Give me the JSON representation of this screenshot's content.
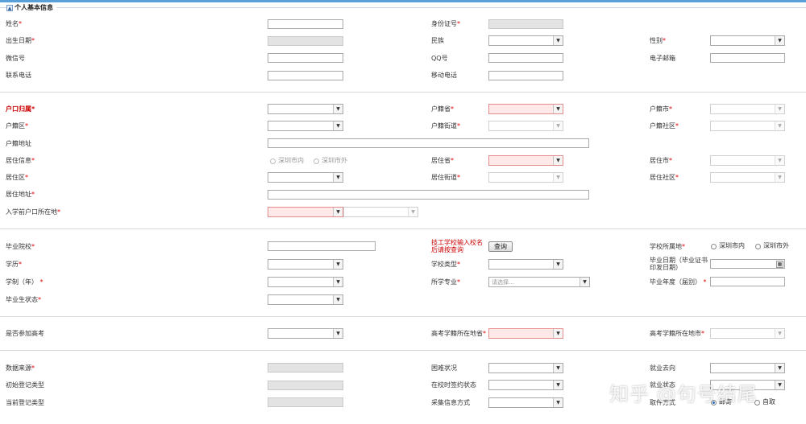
{
  "section_title": "个人基本信息",
  "collapse_glyph": "▲",
  "labels": {
    "name": "姓名",
    "id_no": "身份证号",
    "birth": "出生日期",
    "ethnic": "民族",
    "gender": "性别",
    "wechat": "微信号",
    "qq": "QQ号",
    "email": "电子邮箱",
    "phone": "联系电话",
    "mobile": "移动电话",
    "hukou": "户口归属",
    "hj_prov": "户籍省",
    "hj_city": "户籍市",
    "hj_dist": "户籍区",
    "hj_street": "户籍街道",
    "hj_comm": "户籍社区",
    "hj_addr": "户籍地址",
    "res_info": "居住信息",
    "res_prov": "居住省",
    "res_city": "居住市",
    "res_dist": "居住区",
    "res_street": "居住街道",
    "res_comm": "居住社区",
    "res_addr": "居住地址",
    "pre_hukou": "入学前户口所在地",
    "grad_school": "毕业院校",
    "school_loc": "学校所属地",
    "edu": "学历",
    "school_type": "学校类型",
    "grad_date": "毕业日期（毕业证书印发日期）",
    "length": "学制（年）",
    "major": "所学专业",
    "grad_year": "毕业年度（届别）",
    "grad_status": "毕业生状态",
    "gaokao": "是否参加高考",
    "gk_prov": "高考学籍所在地省",
    "gk_city": "高考学籍所在地市",
    "source": "数据来源",
    "hardship": "困难状况",
    "emp_dir": "就业去向",
    "init_type": "初始登记类型",
    "sign_status": "在校时签约状态",
    "emp_status": "就业状态",
    "cur_type": "当前登记类型",
    "collect": "采集信息方式",
    "fetch": "取件方式"
  },
  "school_note": "技工学校输入校名后请按查询",
  "query_button": "查询",
  "radios": {
    "sz_in": "深圳市内",
    "sz_out": "深圳市外",
    "mail": "邮寄",
    "self": "自取"
  },
  "major_placeholder": "请选择...",
  "required_mark": "*",
  "watermark": "知乎 @句号结尾"
}
